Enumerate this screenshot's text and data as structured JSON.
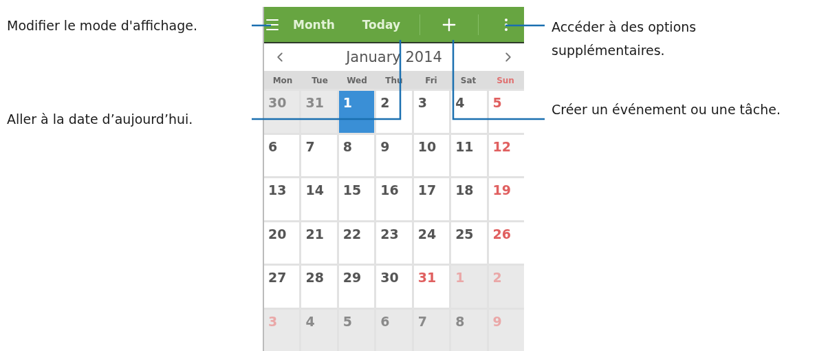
{
  "left_callouts": [
    {
      "text": "Modifier le mode d'affichage."
    },
    {
      "text": "Aller à la date d’aujourd’hui."
    }
  ],
  "right_callouts": [
    {
      "text": "Accéder à des options supplémentaires."
    },
    {
      "text": "Créer un événement ou une tâche."
    }
  ],
  "calendar": {
    "view_label": "Month",
    "today_label": "Today",
    "title": "January 2014",
    "weekdays": [
      {
        "label": "Mon",
        "holiday": false
      },
      {
        "label": "Tue",
        "holiday": false
      },
      {
        "label": "Wed",
        "holiday": false
      },
      {
        "label": "Thu",
        "holiday": false
      },
      {
        "label": "Fri",
        "holiday": false
      },
      {
        "label": "Sat",
        "holiday": false
      },
      {
        "label": "Sun",
        "holiday": true
      }
    ],
    "weeks": [
      [
        {
          "day": "30",
          "outside": true,
          "holiday": false,
          "selected": false
        },
        {
          "day": "31",
          "outside": true,
          "holiday": false,
          "selected": false
        },
        {
          "day": "1",
          "outside": false,
          "holiday": false,
          "selected": true
        },
        {
          "day": "2",
          "outside": false,
          "holiday": false,
          "selected": false
        },
        {
          "day": "3",
          "outside": false,
          "holiday": false,
          "selected": false
        },
        {
          "day": "4",
          "outside": false,
          "holiday": false,
          "selected": false
        },
        {
          "day": "5",
          "outside": false,
          "holiday": true,
          "selected": false
        }
      ],
      [
        {
          "day": "6",
          "outside": false,
          "holiday": false,
          "selected": false
        },
        {
          "day": "7",
          "outside": false,
          "holiday": false,
          "selected": false
        },
        {
          "day": "8",
          "outside": false,
          "holiday": false,
          "selected": false
        },
        {
          "day": "9",
          "outside": false,
          "holiday": false,
          "selected": false
        },
        {
          "day": "10",
          "outside": false,
          "holiday": false,
          "selected": false
        },
        {
          "day": "11",
          "outside": false,
          "holiday": false,
          "selected": false
        },
        {
          "day": "12",
          "outside": false,
          "holiday": true,
          "selected": false
        }
      ],
      [
        {
          "day": "13",
          "outside": false,
          "holiday": false,
          "selected": false
        },
        {
          "day": "14",
          "outside": false,
          "holiday": false,
          "selected": false
        },
        {
          "day": "15",
          "outside": false,
          "holiday": false,
          "selected": false
        },
        {
          "day": "16",
          "outside": false,
          "holiday": false,
          "selected": false
        },
        {
          "day": "17",
          "outside": false,
          "holiday": false,
          "selected": false
        },
        {
          "day": "18",
          "outside": false,
          "holiday": false,
          "selected": false
        },
        {
          "day": "19",
          "outside": false,
          "holiday": true,
          "selected": false
        }
      ],
      [
        {
          "day": "20",
          "outside": false,
          "holiday": false,
          "selected": false
        },
        {
          "day": "21",
          "outside": false,
          "holiday": false,
          "selected": false
        },
        {
          "day": "22",
          "outside": false,
          "holiday": false,
          "selected": false
        },
        {
          "day": "23",
          "outside": false,
          "holiday": false,
          "selected": false
        },
        {
          "day": "24",
          "outside": false,
          "holiday": false,
          "selected": false
        },
        {
          "day": "25",
          "outside": false,
          "holiday": false,
          "selected": false
        },
        {
          "day": "26",
          "outside": false,
          "holiday": true,
          "selected": false
        }
      ],
      [
        {
          "day": "27",
          "outside": false,
          "holiday": false,
          "selected": false
        },
        {
          "day": "28",
          "outside": false,
          "holiday": false,
          "selected": false
        },
        {
          "day": "29",
          "outside": false,
          "holiday": false,
          "selected": false
        },
        {
          "day": "30",
          "outside": false,
          "holiday": false,
          "selected": false
        },
        {
          "day": "31",
          "outside": false,
          "holiday": true,
          "selected": false
        },
        {
          "day": "1",
          "outside": true,
          "holiday": true,
          "selected": false
        },
        {
          "day": "2",
          "outside": true,
          "holiday": true,
          "selected": false
        }
      ],
      [
        {
          "day": "3",
          "outside": true,
          "holiday": true,
          "selected": false
        },
        {
          "day": "4",
          "outside": true,
          "holiday": false,
          "selected": false
        },
        {
          "day": "5",
          "outside": true,
          "holiday": false,
          "selected": false
        },
        {
          "day": "6",
          "outside": true,
          "holiday": false,
          "selected": false
        },
        {
          "day": "7",
          "outside": true,
          "holiday": false,
          "selected": false
        },
        {
          "day": "8",
          "outside": true,
          "holiday": false,
          "selected": false
        },
        {
          "day": "9",
          "outside": true,
          "holiday": true,
          "selected": false
        }
      ]
    ]
  }
}
